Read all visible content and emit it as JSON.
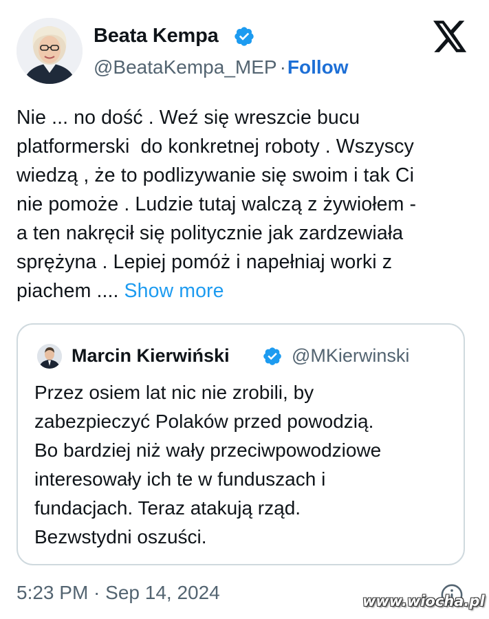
{
  "author": {
    "name": "Beata Kempa",
    "handle": "@BeataKempa_MEP",
    "separator": "·",
    "follow_label": "Follow"
  },
  "tweet": {
    "lines": [
      "Nie ... no dość . Weź się wreszcie bucu",
      "platformerski  do konkretnej roboty . Wszyscy",
      "wiedzą , że to podlizywanie się swoim i tak Ci",
      "nie pomoże . Ludzie tutaj walczą z żywiołem -",
      "a ten nakręcił się politycznie jak zardzewiała",
      "sprężyna . Lepiej pomóż i napełniaj worki z",
      "piachem .... "
    ],
    "show_more_label": "Show more"
  },
  "quote": {
    "name": "Marcin Kierwiński",
    "handle": "@MKierwinski",
    "lines": [
      "Przez osiem lat nic nie zrobili, by",
      "zabezpieczyć Polaków przed powodzią.",
      "Bo bardziej niż wały przeciwpowodziowe",
      "interesowały ich te w funduszach i",
      "fundacjach. Teraz atakują rząd.",
      "Bezwstydni oszuści."
    ]
  },
  "timestamp": "5:23 PM · Sep 14, 2024",
  "watermark": "www.wiocha.pl",
  "icons": {
    "verified": "verified-badge-icon",
    "logo": "x-logo-icon",
    "info": "info-icon"
  },
  "colors": {
    "verified_blue": "#1d9bf0",
    "follow_blue": "#1d6fd6",
    "text": "#0f1419",
    "secondary": "#536471"
  }
}
